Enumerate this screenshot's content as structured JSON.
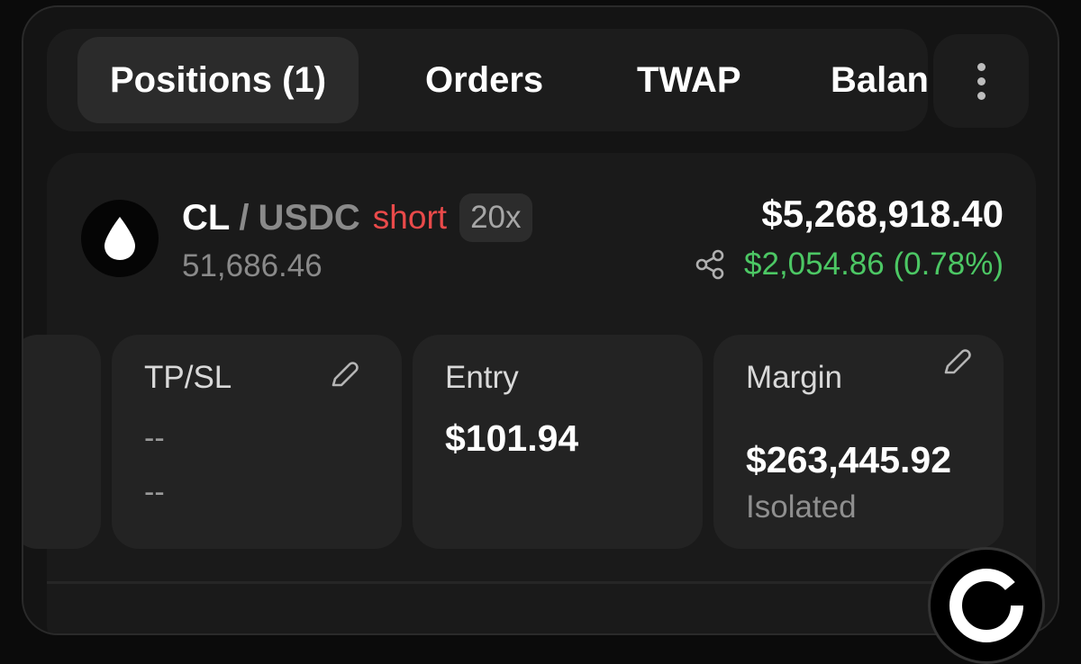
{
  "tabs": [
    {
      "label": "Positions (1)",
      "active": true
    },
    {
      "label": "Orders",
      "active": false
    },
    {
      "label": "TWAP",
      "active": false
    },
    {
      "label": "Balan",
      "active": false
    }
  ],
  "more_icon": "vertical-ellipsis-icon",
  "position": {
    "coin_icon": "drop-icon",
    "coin": "CL",
    "separator": "/",
    "quote": "USDC",
    "side": "short",
    "leverage": "20x",
    "size": "51,686.46",
    "value": "$5,268,918.40",
    "pnl": "$2,054.86 (0.78%)",
    "colors": {
      "short": "#ea4a4a",
      "pnl_positive": "#4cc764"
    }
  },
  "tpsl": {
    "label": "TP/SL",
    "tp": "--",
    "sl": "--"
  },
  "entry": {
    "label": "Entry",
    "value": "$101.94"
  },
  "margin": {
    "label": "Margin",
    "value": "$263,445.92",
    "mode": "Isolated"
  }
}
